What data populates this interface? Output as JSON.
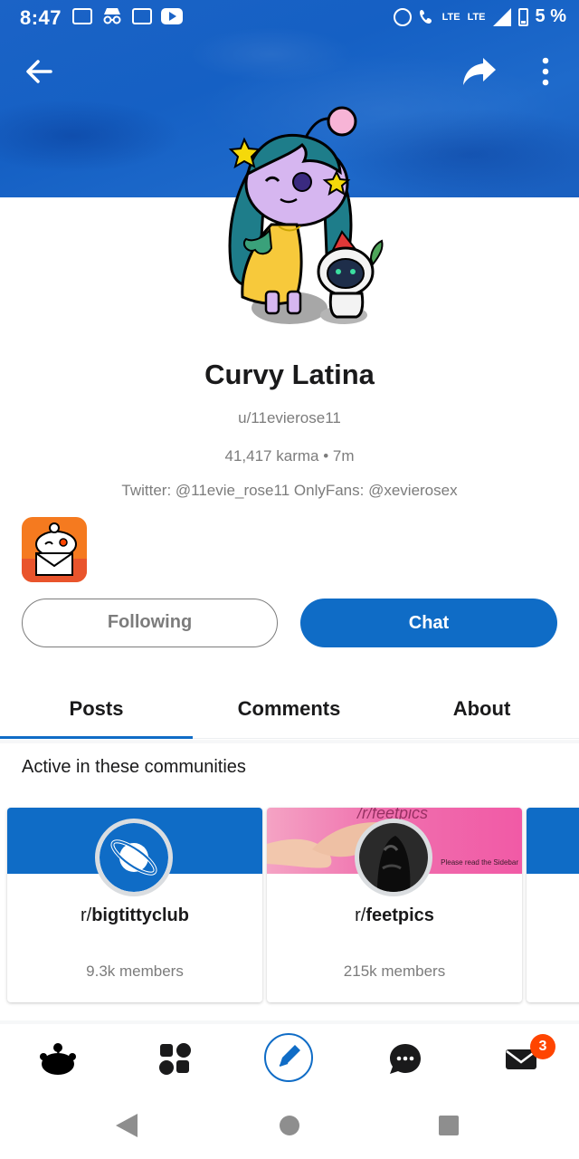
{
  "status_bar": {
    "time": "8:47",
    "network": "LTE",
    "network2": "LTE",
    "battery": "5 %"
  },
  "header": {
    "back_icon": "arrow-left-icon",
    "share_icon": "share-icon",
    "more_icon": "more-vertical-icon"
  },
  "profile": {
    "display_name": "Curvy Latina",
    "username": "u/11evierose11",
    "meta": "41,417 karma • 7m",
    "description": "Twitter: @11evie_rose11 OnlyFans: @xevierosex"
  },
  "actions": {
    "following_label": "Following",
    "chat_label": "Chat"
  },
  "tabs": [
    {
      "label": "Posts",
      "selected": true
    },
    {
      "label": "Comments",
      "selected": false
    },
    {
      "label": "About",
      "selected": false
    }
  ],
  "communities": {
    "title": "Active in these communities",
    "items": [
      {
        "prefix": "r/",
        "name": "bigtittyclub",
        "members": "9.3k members"
      },
      {
        "prefix": "r/",
        "name": "feetpics",
        "members": "215k members",
        "banner_text": "/r/feetpics",
        "banner_note": "Please read the Sidebar"
      }
    ]
  },
  "bottom_nav": {
    "inbox_badge": "3"
  },
  "colors": {
    "accent": "#0f6cc6",
    "badge": "#ff4500",
    "banner": "#1b63c6"
  }
}
